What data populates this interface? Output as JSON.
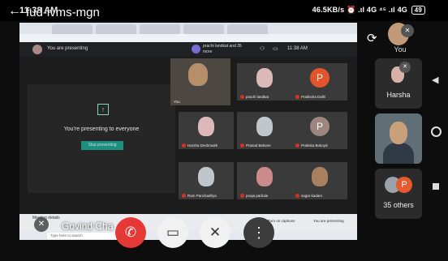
{
  "status_bar": {
    "time": "11:38 AM",
    "right": "46.5KB/s ⏰ .ıl 4G ⁴⁵ .ıl 4G",
    "battery": "49"
  },
  "meeting": {
    "code": "fud-ivms-mgn",
    "presenter_name": "Govind Cha"
  },
  "shared_screen": {
    "you_presenting": "You are presenting",
    "joined": "prachi landkat and 35 more",
    "meet_time": "11:38 AM",
    "presenting_message": "You're presenting to everyone",
    "stop_button": "Stop presenting",
    "meeting_details": "Meeting details",
    "turn_on_captions": "Turn on captions",
    "you_are_presenting_btn": "You are presenting",
    "search_placeholder": "Type here to search",
    "tiles": [
      {
        "name": "You"
      },
      {
        "name": "prachi landkat"
      },
      {
        "name": "Pratiksha Dalhi",
        "letter": "P",
        "color": "#e2552c"
      },
      {
        "name": "Harsha Deshmukh"
      },
      {
        "name": "Prasad Belsare"
      },
      {
        "name": "Pratiska Bokoyd",
        "letter": "P",
        "color": "#9e8680"
      },
      {
        "name": "Ram Panchadhya"
      },
      {
        "name": "pooja parbale"
      },
      {
        "name": "sagar kadam"
      }
    ]
  },
  "controls": {
    "end_call": "end-call",
    "camera": "camera-off",
    "mic": "mic-off",
    "more": "more"
  },
  "sidebar": {
    "self_label": "You",
    "participant_name": "Harsha",
    "others_label": "35 others",
    "others_letter": "P"
  }
}
